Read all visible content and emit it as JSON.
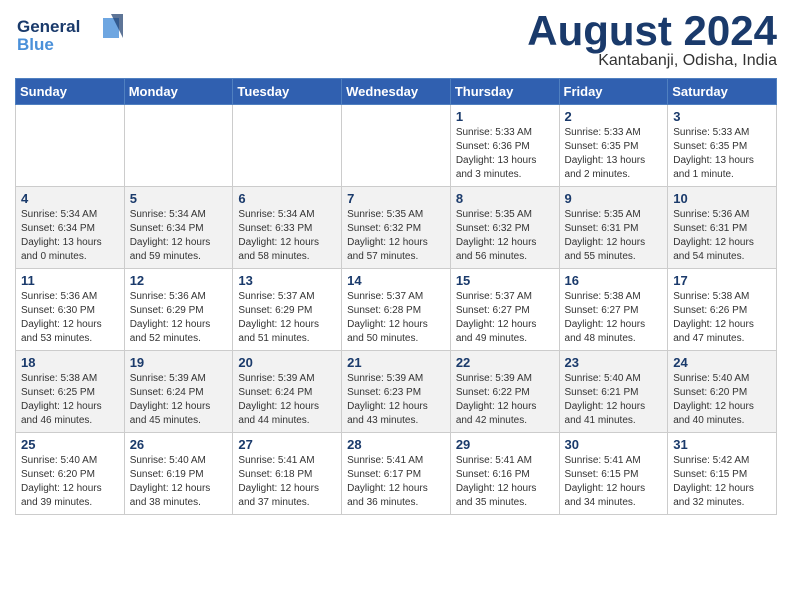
{
  "header": {
    "logo_line1": "General",
    "logo_line2": "Blue",
    "month_year": "August 2024",
    "location": "Kantabanji, Odisha, India"
  },
  "days_of_week": [
    "Sunday",
    "Monday",
    "Tuesday",
    "Wednesday",
    "Thursday",
    "Friday",
    "Saturday"
  ],
  "weeks": [
    {
      "days": [
        {
          "num": "",
          "detail": ""
        },
        {
          "num": "",
          "detail": ""
        },
        {
          "num": "",
          "detail": ""
        },
        {
          "num": "",
          "detail": ""
        },
        {
          "num": "1",
          "detail": "Sunrise: 5:33 AM\nSunset: 6:36 PM\nDaylight: 13 hours\nand 3 minutes."
        },
        {
          "num": "2",
          "detail": "Sunrise: 5:33 AM\nSunset: 6:35 PM\nDaylight: 13 hours\nand 2 minutes."
        },
        {
          "num": "3",
          "detail": "Sunrise: 5:33 AM\nSunset: 6:35 PM\nDaylight: 13 hours\nand 1 minute."
        }
      ]
    },
    {
      "days": [
        {
          "num": "4",
          "detail": "Sunrise: 5:34 AM\nSunset: 6:34 PM\nDaylight: 13 hours\nand 0 minutes."
        },
        {
          "num": "5",
          "detail": "Sunrise: 5:34 AM\nSunset: 6:34 PM\nDaylight: 12 hours\nand 59 minutes."
        },
        {
          "num": "6",
          "detail": "Sunrise: 5:34 AM\nSunset: 6:33 PM\nDaylight: 12 hours\nand 58 minutes."
        },
        {
          "num": "7",
          "detail": "Sunrise: 5:35 AM\nSunset: 6:32 PM\nDaylight: 12 hours\nand 57 minutes."
        },
        {
          "num": "8",
          "detail": "Sunrise: 5:35 AM\nSunset: 6:32 PM\nDaylight: 12 hours\nand 56 minutes."
        },
        {
          "num": "9",
          "detail": "Sunrise: 5:35 AM\nSunset: 6:31 PM\nDaylight: 12 hours\nand 55 minutes."
        },
        {
          "num": "10",
          "detail": "Sunrise: 5:36 AM\nSunset: 6:31 PM\nDaylight: 12 hours\nand 54 minutes."
        }
      ]
    },
    {
      "days": [
        {
          "num": "11",
          "detail": "Sunrise: 5:36 AM\nSunset: 6:30 PM\nDaylight: 12 hours\nand 53 minutes."
        },
        {
          "num": "12",
          "detail": "Sunrise: 5:36 AM\nSunset: 6:29 PM\nDaylight: 12 hours\nand 52 minutes."
        },
        {
          "num": "13",
          "detail": "Sunrise: 5:37 AM\nSunset: 6:29 PM\nDaylight: 12 hours\nand 51 minutes."
        },
        {
          "num": "14",
          "detail": "Sunrise: 5:37 AM\nSunset: 6:28 PM\nDaylight: 12 hours\nand 50 minutes."
        },
        {
          "num": "15",
          "detail": "Sunrise: 5:37 AM\nSunset: 6:27 PM\nDaylight: 12 hours\nand 49 minutes."
        },
        {
          "num": "16",
          "detail": "Sunrise: 5:38 AM\nSunset: 6:27 PM\nDaylight: 12 hours\nand 48 minutes."
        },
        {
          "num": "17",
          "detail": "Sunrise: 5:38 AM\nSunset: 6:26 PM\nDaylight: 12 hours\nand 47 minutes."
        }
      ]
    },
    {
      "days": [
        {
          "num": "18",
          "detail": "Sunrise: 5:38 AM\nSunset: 6:25 PM\nDaylight: 12 hours\nand 46 minutes."
        },
        {
          "num": "19",
          "detail": "Sunrise: 5:39 AM\nSunset: 6:24 PM\nDaylight: 12 hours\nand 45 minutes."
        },
        {
          "num": "20",
          "detail": "Sunrise: 5:39 AM\nSunset: 6:24 PM\nDaylight: 12 hours\nand 44 minutes."
        },
        {
          "num": "21",
          "detail": "Sunrise: 5:39 AM\nSunset: 6:23 PM\nDaylight: 12 hours\nand 43 minutes."
        },
        {
          "num": "22",
          "detail": "Sunrise: 5:39 AM\nSunset: 6:22 PM\nDaylight: 12 hours\nand 42 minutes."
        },
        {
          "num": "23",
          "detail": "Sunrise: 5:40 AM\nSunset: 6:21 PM\nDaylight: 12 hours\nand 41 minutes."
        },
        {
          "num": "24",
          "detail": "Sunrise: 5:40 AM\nSunset: 6:20 PM\nDaylight: 12 hours\nand 40 minutes."
        }
      ]
    },
    {
      "days": [
        {
          "num": "25",
          "detail": "Sunrise: 5:40 AM\nSunset: 6:20 PM\nDaylight: 12 hours\nand 39 minutes."
        },
        {
          "num": "26",
          "detail": "Sunrise: 5:40 AM\nSunset: 6:19 PM\nDaylight: 12 hours\nand 38 minutes."
        },
        {
          "num": "27",
          "detail": "Sunrise: 5:41 AM\nSunset: 6:18 PM\nDaylight: 12 hours\nand 37 minutes."
        },
        {
          "num": "28",
          "detail": "Sunrise: 5:41 AM\nSunset: 6:17 PM\nDaylight: 12 hours\nand 36 minutes."
        },
        {
          "num": "29",
          "detail": "Sunrise: 5:41 AM\nSunset: 6:16 PM\nDaylight: 12 hours\nand 35 minutes."
        },
        {
          "num": "30",
          "detail": "Sunrise: 5:41 AM\nSunset: 6:15 PM\nDaylight: 12 hours\nand 34 minutes."
        },
        {
          "num": "31",
          "detail": "Sunrise: 5:42 AM\nSunset: 6:15 PM\nDaylight: 12 hours\nand 32 minutes."
        }
      ]
    }
  ]
}
